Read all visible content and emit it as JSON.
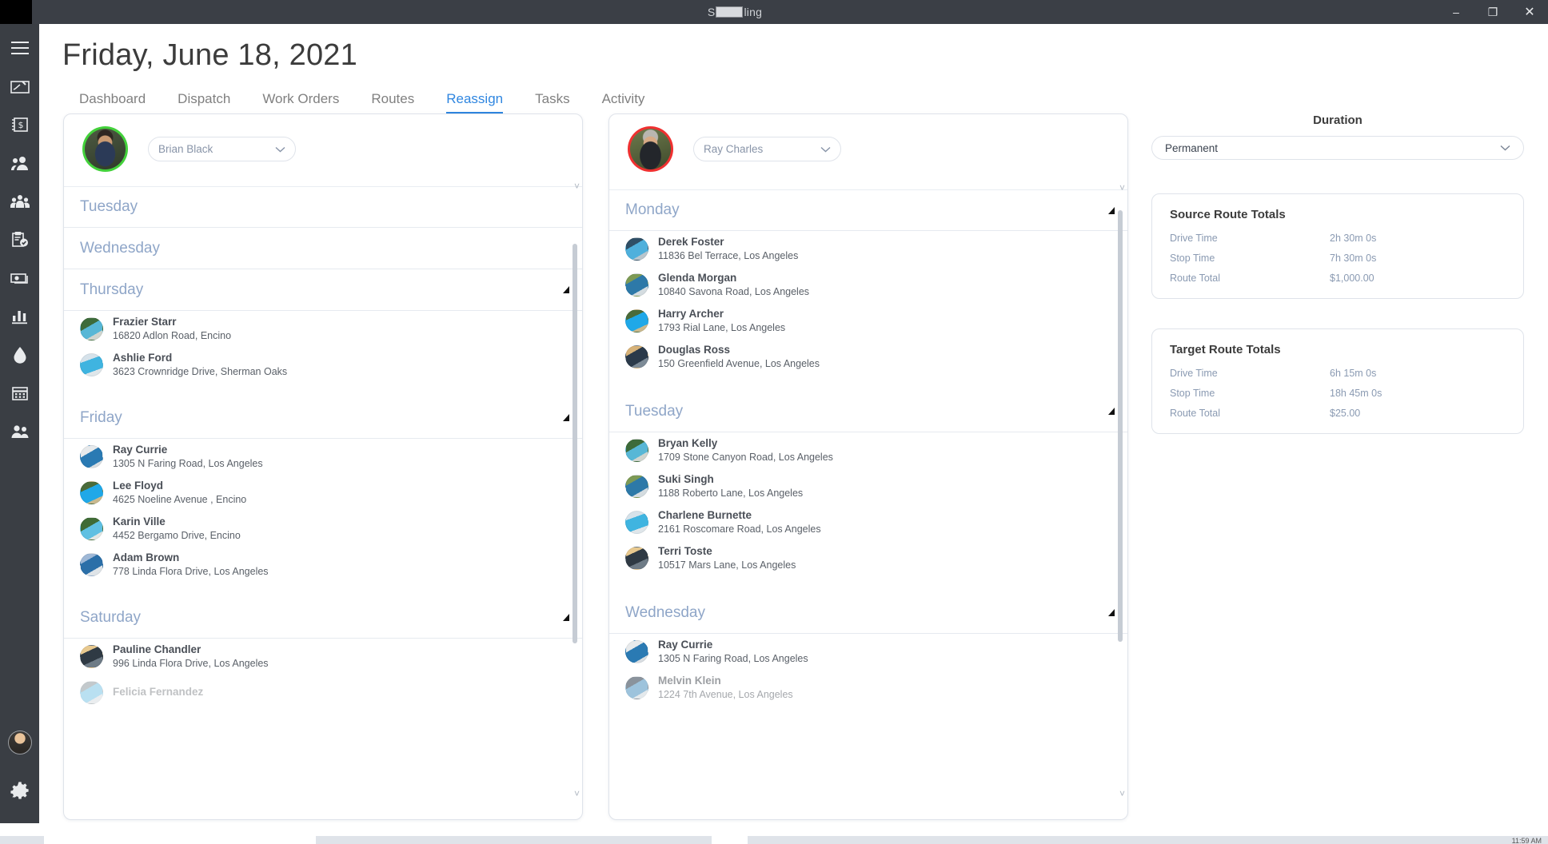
{
  "window": {
    "title_prefix": "S",
    "title_suffix": "ling",
    "minimize": "–",
    "maximize": "❐",
    "close": "✕"
  },
  "rail": {
    "items": [
      {
        "name": "hamburger-menu-icon",
        "label": "Menu"
      },
      {
        "name": "signature-icon",
        "label": "Sign"
      },
      {
        "name": "invoice-dollar-icon",
        "label": "Billing"
      },
      {
        "name": "users-icon",
        "label": "Customers"
      },
      {
        "name": "team-icon",
        "label": "Team"
      },
      {
        "name": "clipboard-check-icon",
        "label": "Work Orders"
      },
      {
        "name": "cash-icon",
        "label": "Payments"
      },
      {
        "name": "bar-chart-icon",
        "label": "Reports"
      },
      {
        "name": "water-drop-icon",
        "label": "Chemicals"
      },
      {
        "name": "calendar-icon",
        "label": "Schedule"
      },
      {
        "name": "people-icon",
        "label": "Staff"
      }
    ],
    "avatar_label": "User Avatar",
    "settings_label": "Settings"
  },
  "header": {
    "page_title": "Friday, June 18, 2021",
    "tabs": [
      {
        "label": "Dashboard",
        "active": false
      },
      {
        "label": "Dispatch",
        "active": false
      },
      {
        "label": "Work Orders",
        "active": false
      },
      {
        "label": "Routes",
        "active": false
      },
      {
        "label": "Reassign",
        "active": true
      },
      {
        "label": "Tasks",
        "active": false
      },
      {
        "label": "Activity",
        "active": false
      }
    ]
  },
  "source_route": {
    "driver": "Brian Black",
    "avatar_status_color": "#43d13b",
    "days": [
      {
        "day": "Tuesday",
        "collapsed": true,
        "stops": []
      },
      {
        "day": "Wednesday",
        "collapsed": true,
        "stops": []
      },
      {
        "day": "Thursday",
        "collapsed": false,
        "stops": [
          {
            "name": "Frazier Starr",
            "address": "16820 Adlon Road, Encino"
          },
          {
            "name": "Ashlie Ford",
            "address": "3623 Crownridge Drive, Sherman Oaks"
          }
        ]
      },
      {
        "day": "Friday",
        "collapsed": false,
        "stops": [
          {
            "name": "Ray Currie",
            "address": "1305 N Faring Road, Los Angeles"
          },
          {
            "name": "Lee Floyd",
            "address": "4625 Noeline Avenue , Encino"
          },
          {
            "name": "Karin Ville",
            "address": "4452 Bergamo Drive, Encino"
          },
          {
            "name": "Adam Brown",
            "address": "778 Linda Flora Drive, Los Angeles"
          }
        ]
      },
      {
        "day": "Saturday",
        "collapsed": false,
        "stops": [
          {
            "name": "Pauline Chandler",
            "address": "996 Linda Flora Drive, Los Angeles"
          },
          {
            "name": "Felicia Fernandez",
            "address": ""
          }
        ]
      }
    ]
  },
  "target_route": {
    "driver": "Ray Charles",
    "avatar_status_color": "#ef3030",
    "days": [
      {
        "day": "Monday",
        "collapsed": false,
        "stops": [
          {
            "name": "Derek Foster",
            "address": "11836 Bel Terrace, Los Angeles"
          },
          {
            "name": "Glenda Morgan",
            "address": "10840 Savona Road, Los Angeles"
          },
          {
            "name": "Harry Archer",
            "address": "1793 Rial Lane, Los Angeles"
          },
          {
            "name": "Douglas Ross",
            "address": "150 Greenfield Avenue, Los Angeles"
          }
        ]
      },
      {
        "day": "Tuesday",
        "collapsed": false,
        "stops": [
          {
            "name": "Bryan Kelly",
            "address": "1709 Stone Canyon Road, Los Angeles"
          },
          {
            "name": "Suki Singh",
            "address": "1188 Roberto Lane, Los Angeles"
          },
          {
            "name": "Charlene Burnette",
            "address": "2161 Roscomare  Road, Los Angeles"
          },
          {
            "name": "Terri Toste",
            "address": "10517 Mars Lane, Los Angeles"
          }
        ]
      },
      {
        "day": "Wednesday",
        "collapsed": false,
        "stops": [
          {
            "name": "Ray Currie",
            "address": "1305 N Faring Road, Los Angeles"
          },
          {
            "name": "Melvin Klein",
            "address": "1224 7th Avenue, Los Angeles"
          }
        ]
      }
    ]
  },
  "side_panel": {
    "duration_label": "Duration",
    "duration_value": "Permanent",
    "source_totals": {
      "title": "Source Route Totals",
      "rows": [
        {
          "key": "Drive Time",
          "value": "2h 30m 0s"
        },
        {
          "key": "Stop Time",
          "value": "7h 30m 0s"
        },
        {
          "key": "Route Total",
          "value": "$1,000.00"
        }
      ]
    },
    "target_totals": {
      "title": "Target Route Totals",
      "rows": [
        {
          "key": "Drive Time",
          "value": "6h 15m 0s"
        },
        {
          "key": "Stop Time",
          "value": "18h 45m 0s"
        },
        {
          "key": "Route Total",
          "value": "$25.00"
        }
      ]
    }
  },
  "taskbar": {
    "clock": "11:59 AM"
  }
}
